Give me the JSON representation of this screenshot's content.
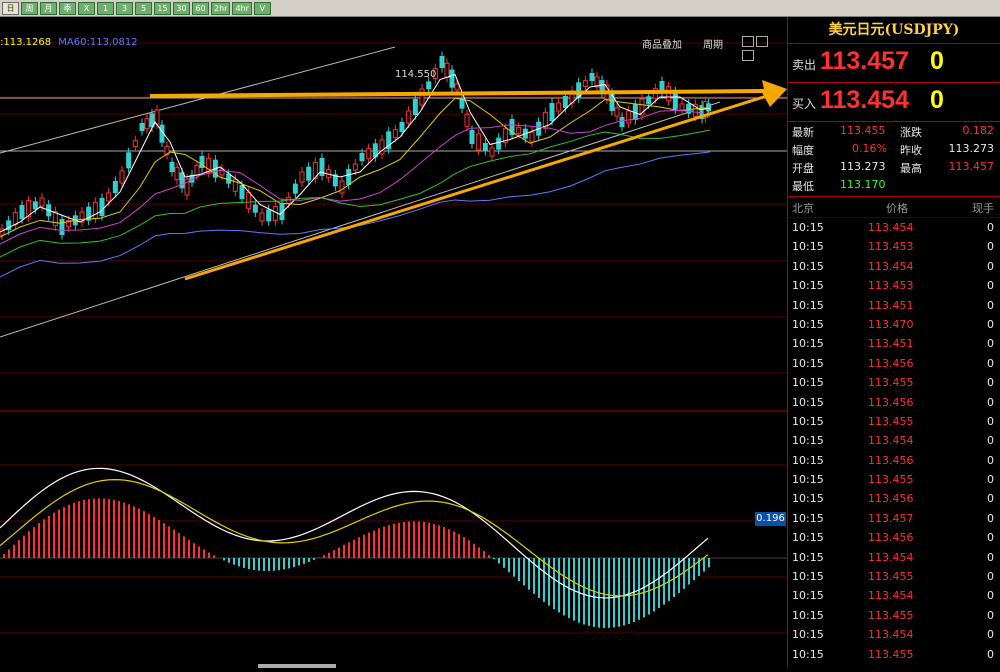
{
  "toolbar": {
    "buttons": [
      "日",
      "周",
      "月",
      "季",
      "X",
      "1",
      "3",
      "5",
      "15",
      "30",
      "60",
      "2hr",
      "4hr",
      "V"
    ]
  },
  "chart": {
    "ma_legend": {
      "first": ":113.1268",
      "second": "MA60:113.0812"
    },
    "peak_label": "114.550",
    "top_links": {
      "overlay": "商品叠加",
      "period": "周期"
    },
    "macd_value": "0.196",
    "colors": {
      "up": "#ff3030",
      "down": "#30d0d0",
      "trend": "#f6a800"
    }
  },
  "panel": {
    "title": "美元日元(USDJPY)",
    "sell": {
      "label": "卖出",
      "price": "113.457",
      "volume": "0"
    },
    "buy": {
      "label": "买入",
      "price": "113.454",
      "volume": "0"
    },
    "stats": {
      "latest_label": "最新",
      "latest": "113.455",
      "change_label": "涨跌",
      "change": "0.182",
      "range_label": "幅度",
      "range": "0.16%",
      "prev_close_label": "昨收",
      "prev_close": "113.273",
      "open_label": "开盘",
      "open": "113.273",
      "high_label": "最高",
      "high": "113.457",
      "low_label": "最低",
      "low": "113.170"
    },
    "ticks_header": {
      "time": "北京",
      "price": "价格",
      "volume": "现手"
    },
    "ticks": [
      {
        "time": "10:15",
        "price": "113.454",
        "vol": "0"
      },
      {
        "time": "10:15",
        "price": "113.453",
        "vol": "0"
      },
      {
        "time": "10:15",
        "price": "113.454",
        "vol": "0"
      },
      {
        "time": "10:15",
        "price": "113.453",
        "vol": "0"
      },
      {
        "time": "10:15",
        "price": "113.451",
        "vol": "0"
      },
      {
        "time": "10:15",
        "price": "113.470",
        "vol": "0"
      },
      {
        "time": "10:15",
        "price": "113.451",
        "vol": "0"
      },
      {
        "time": "10:15",
        "price": "113.456",
        "vol": "0"
      },
      {
        "time": "10:15",
        "price": "113.455",
        "vol": "0"
      },
      {
        "time": "10:15",
        "price": "113.456",
        "vol": "0"
      },
      {
        "time": "10:15",
        "price": "113.455",
        "vol": "0"
      },
      {
        "time": "10:15",
        "price": "113.454",
        "vol": "0"
      },
      {
        "time": "10:15",
        "price": "113.456",
        "vol": "0"
      },
      {
        "time": "10:15",
        "price": "113.455",
        "vol": "0"
      },
      {
        "time": "10:15",
        "price": "113.456",
        "vol": "0"
      },
      {
        "time": "10:15",
        "price": "113.457",
        "vol": "0"
      },
      {
        "time": "10:15",
        "price": "113.456",
        "vol": "0"
      },
      {
        "time": "10:15",
        "price": "113.454",
        "vol": "0"
      },
      {
        "time": "10:15",
        "price": "113.455",
        "vol": "0"
      },
      {
        "time": "10:15",
        "price": "113.454",
        "vol": "0"
      },
      {
        "time": "10:15",
        "price": "113.455",
        "vol": "0"
      },
      {
        "time": "10:15",
        "price": "113.454",
        "vol": "0"
      },
      {
        "time": "10:15",
        "price": "113.455",
        "vol": "0"
      }
    ]
  }
}
